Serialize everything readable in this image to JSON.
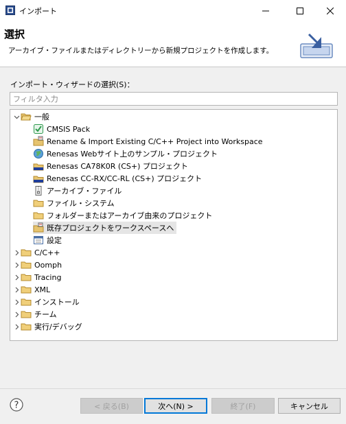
{
  "window": {
    "title": "インポート",
    "controls": {
      "minimize": "minimize",
      "maximize": "maximize",
      "close": "close"
    }
  },
  "banner": {
    "title": "選択",
    "description": "アーカイブ・ファイルまたはディレクトリーから新規プロジェクトを作成します。"
  },
  "filter": {
    "label": "インポート・ウィザードの選択(S)：",
    "placeholder": "フィルタ入力",
    "value": ""
  },
  "tree": [
    {
      "label": "一般",
      "icon": "folder-open-icon",
      "expanded": true,
      "level": 0
    },
    {
      "label": "CMSIS Pack",
      "icon": "cmsis-pack-icon",
      "level": 1
    },
    {
      "label": "Rename & Import Existing C/C++ Project into Workspace",
      "icon": "import-project-icon",
      "level": 1
    },
    {
      "label": "Renesas Webサイト上のサンプル・プロジェクト",
      "icon": "globe-icon",
      "level": 1
    },
    {
      "label": "Renesas CA78K0R (CS+) プロジェクト",
      "icon": "renesas-project-icon",
      "level": 1
    },
    {
      "label": "Renesas CC-RX/CC-RL (CS+) プロジェクト",
      "icon": "renesas-project-icon",
      "level": 1
    },
    {
      "label": "アーカイブ・ファイル",
      "icon": "archive-icon",
      "level": 1
    },
    {
      "label": "ファイル・システム",
      "icon": "folder-icon",
      "level": 1
    },
    {
      "label": "フォルダーまたはアーカイブ由来のプロジェクト",
      "icon": "folder-icon",
      "level": 1
    },
    {
      "label": "既存プロジェクトをワークスペースへ",
      "icon": "existing-project-icon",
      "level": 1,
      "selected": true
    },
    {
      "label": "設定",
      "icon": "preferences-icon",
      "level": 1
    },
    {
      "label": "C/C++",
      "icon": "folder-icon",
      "expanded": false,
      "level": 0
    },
    {
      "label": "Oomph",
      "icon": "folder-icon",
      "expanded": false,
      "level": 0
    },
    {
      "label": "Tracing",
      "icon": "folder-icon",
      "expanded": false,
      "level": 0
    },
    {
      "label": "XML",
      "icon": "folder-icon",
      "expanded": false,
      "level": 0
    },
    {
      "label": "インストール",
      "icon": "folder-icon",
      "expanded": false,
      "level": 0
    },
    {
      "label": "チーム",
      "icon": "folder-icon",
      "expanded": false,
      "level": 0
    },
    {
      "label": "実行/デバッグ",
      "icon": "folder-icon",
      "expanded": false,
      "level": 0
    }
  ],
  "buttons": {
    "back": "< 戻る(B)",
    "next": "次へ(N) >",
    "finish": "終了(F)",
    "cancel": "キャンセル"
  },
  "colors": {
    "accent": "#0078d7",
    "folder": "#dcb35c",
    "selection": "#e5e5e5"
  }
}
